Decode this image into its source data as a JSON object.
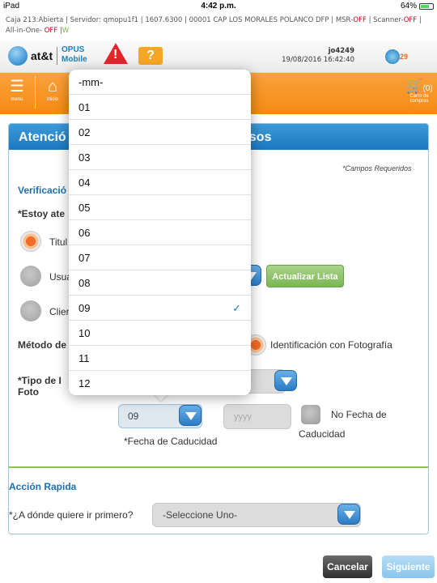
{
  "status_bar": {
    "device": "iPad",
    "time": "4:42 p.m.",
    "battery": "64%"
  },
  "info_line": {
    "prefix": "Caja 213:Abierta | Servidor: qmopu1f1 | 1607.6300 | 00001 CAP LOS MORALES POLANCO DFP | MSR-",
    "msr": "OFF",
    "scanner_label": " | Scanner-",
    "scanner": "OFF",
    "allinone_label": " | All-in-One- ",
    "allinone": "OFF",
    "sep": " |",
    "w": "W"
  },
  "header": {
    "brand": "at&t",
    "app_line1": "OPUS",
    "app_line2": "Mobile",
    "warning_symbol": "!",
    "help_symbol": "?",
    "user_id": "jo4249",
    "datetime": "19/08/2016 16:42:40",
    "notif_count": "29"
  },
  "nav": {
    "menu_label": "menu",
    "home_label": "Inicio",
    "cart_count": "(0)",
    "cart_label_1": "Carro de",
    "cart_label_2": "compras"
  },
  "panel": {
    "title_left": "Atenció",
    "title_right": "asos",
    "required_note": "*Campos Requeridos",
    "verification_label": "Verificació",
    "attending_label": "*Estoy ate",
    "radio_options": [
      "Titul",
      "Usua",
      "Clier"
    ],
    "update_button": "Actualizar Lista",
    "method_label": "Método de",
    "method_value": "Identificación con Fotografía",
    "id_type_label_1": "*Tipo de I",
    "id_type_label_2": "Foto",
    "month_value": "09",
    "year_placeholder": "yyyy",
    "expiry_label": "*Fecha de Caducidad",
    "no_expiry_line1": "No Fecha de",
    "no_expiry_line2": "Caducidad",
    "quick_action_title": "Acción Rapida",
    "where_label": "*¿A dónde quiere ir primero?",
    "where_value": "-Seleccione Uno-"
  },
  "buttons": {
    "cancel": "Cancelar",
    "next": "Siguiente"
  },
  "dropdown": {
    "options": [
      "-mm-",
      "01",
      "02",
      "03",
      "04",
      "05",
      "06",
      "07",
      "08",
      "09",
      "10",
      "11",
      "12"
    ],
    "selected": "09",
    "check": "✓"
  }
}
